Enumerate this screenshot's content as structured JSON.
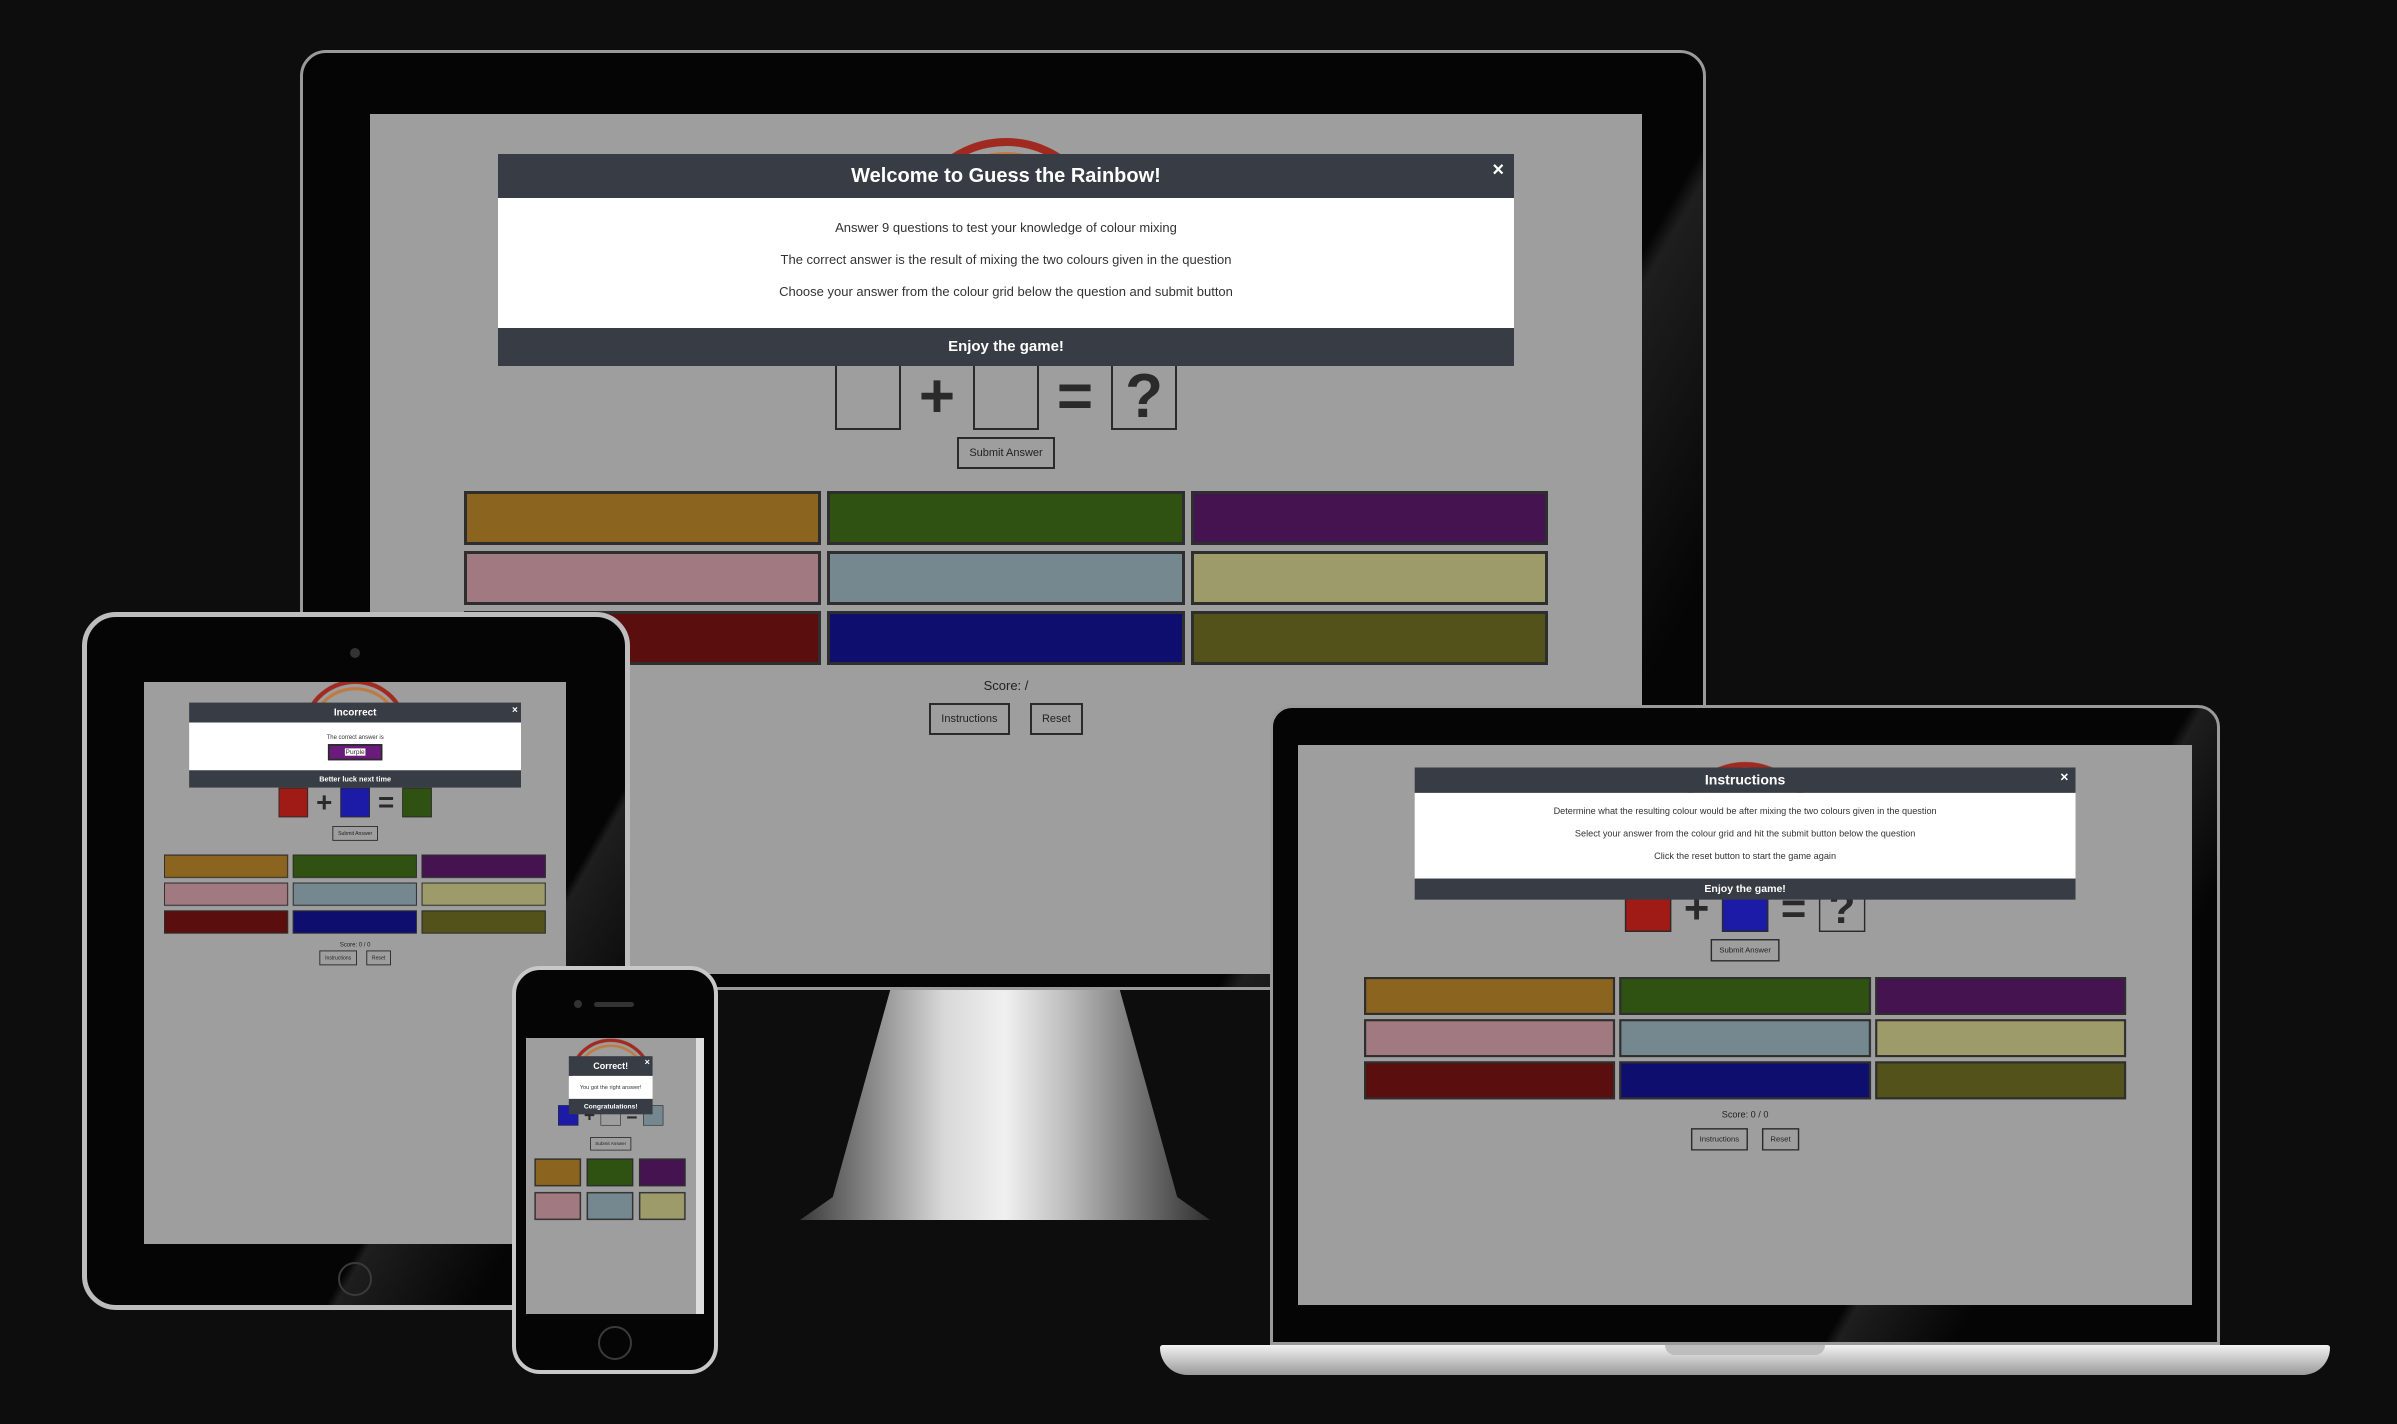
{
  "game": {
    "submit_label": "Submit Answer",
    "instructions_label": "Instructions",
    "reset_label": "Reset",
    "score_monitor": "Score: /",
    "score_played": "Score: 0 / 0",
    "grid_colors": [
      "#8b6520",
      "#2f5213",
      "#45134f",
      "#a07a80",
      "#75888f",
      "#9e9b6b",
      "#5a0e0d",
      "#0e0e6e",
      "#52521a"
    ],
    "q_red": "#a01b16",
    "q_blue": "#1b1ba8",
    "q_green": "#2f5213"
  },
  "monitor_modal": {
    "title": "Welcome to Guess the Rainbow!",
    "lines": [
      "Answer 9 questions to test your knowledge of colour mixing",
      "The correct answer is the result of mixing the two colours given in the question",
      "Choose your answer from the colour grid below the question and submit button"
    ],
    "footer": "Enjoy the game!",
    "close": "×"
  },
  "laptop_modal": {
    "title": "Instructions",
    "lines": [
      "Determine what the resulting colour would be after mixing the two colours given in the question",
      "Select your answer from the colour grid and hit the submit button below the question",
      "Click the reset button to start the game again"
    ],
    "footer": "Enjoy the game!",
    "close": "×"
  },
  "tablet_modal": {
    "title": "Incorrect",
    "line": "The correct answer is",
    "answer": "Purple",
    "footer": "Better luck next time",
    "close": "×"
  },
  "phone_modal": {
    "title": "Correct!",
    "line": "You got the right answer!",
    "footer": "Congratulations!",
    "close": "×"
  }
}
